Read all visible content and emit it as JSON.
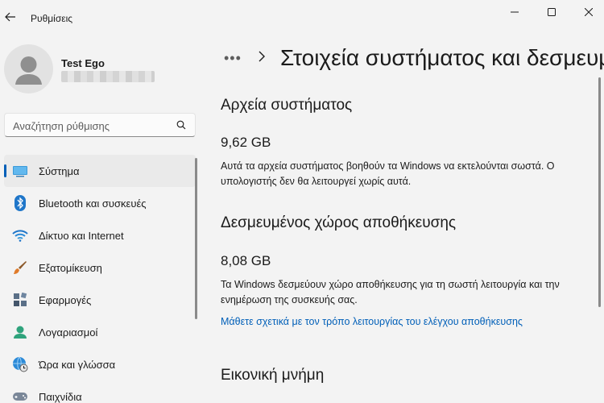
{
  "app": {
    "title": "Ρυθμίσεις"
  },
  "profile": {
    "name": "Test Ego"
  },
  "search": {
    "placeholder": "Αναζήτηση ρύθμισης"
  },
  "nav": {
    "items": [
      {
        "label": "Σύστημα",
        "icon": "system-icon",
        "active": true
      },
      {
        "label": "Bluetooth και συσκευές",
        "icon": "bluetooth-icon"
      },
      {
        "label": "Δίκτυο και Internet",
        "icon": "wifi-icon"
      },
      {
        "label": "Εξατομίκευση",
        "icon": "brush-icon"
      },
      {
        "label": "Εφαρμογές",
        "icon": "apps-icon"
      },
      {
        "label": "Λογαριασμοί",
        "icon": "account-icon"
      },
      {
        "label": "Ώρα και γλώσσα",
        "icon": "globe-clock-icon"
      },
      {
        "label": "Παιχνίδια",
        "icon": "gamepad-icon"
      }
    ]
  },
  "breadcrumb": {
    "more": "•••"
  },
  "page": {
    "title": "Στοιχεία συστήματος και δεσμευμένος χώρος"
  },
  "sections": {
    "system_files": {
      "title": "Αρχεία συστήματος",
      "size": "9,62 GB",
      "description": "Αυτά τα αρχεία συστήματος βοηθούν τα Windows να εκτελούνται σωστά. Ο υπολογιστής δεν θα λειτουργεί χωρίς αυτά."
    },
    "reserved": {
      "title": "Δεσμευμένος χώρος αποθήκευσης",
      "size": "8,08 GB",
      "description": "Τα Windows δεσμεύουν χώρο αποθήκευσης για τη σωστή λειτουργία και την ενημέρωση της συσκευής σας.",
      "link": "Μάθετε σχετικά με τον τρόπο λειτουργίας του ελέγχου αποθήκευσης"
    },
    "virtual_memory": {
      "title": "Εικονική μνήμη"
    }
  },
  "colors": {
    "accent": "#005fb8",
    "background": "#f3f3f3"
  }
}
